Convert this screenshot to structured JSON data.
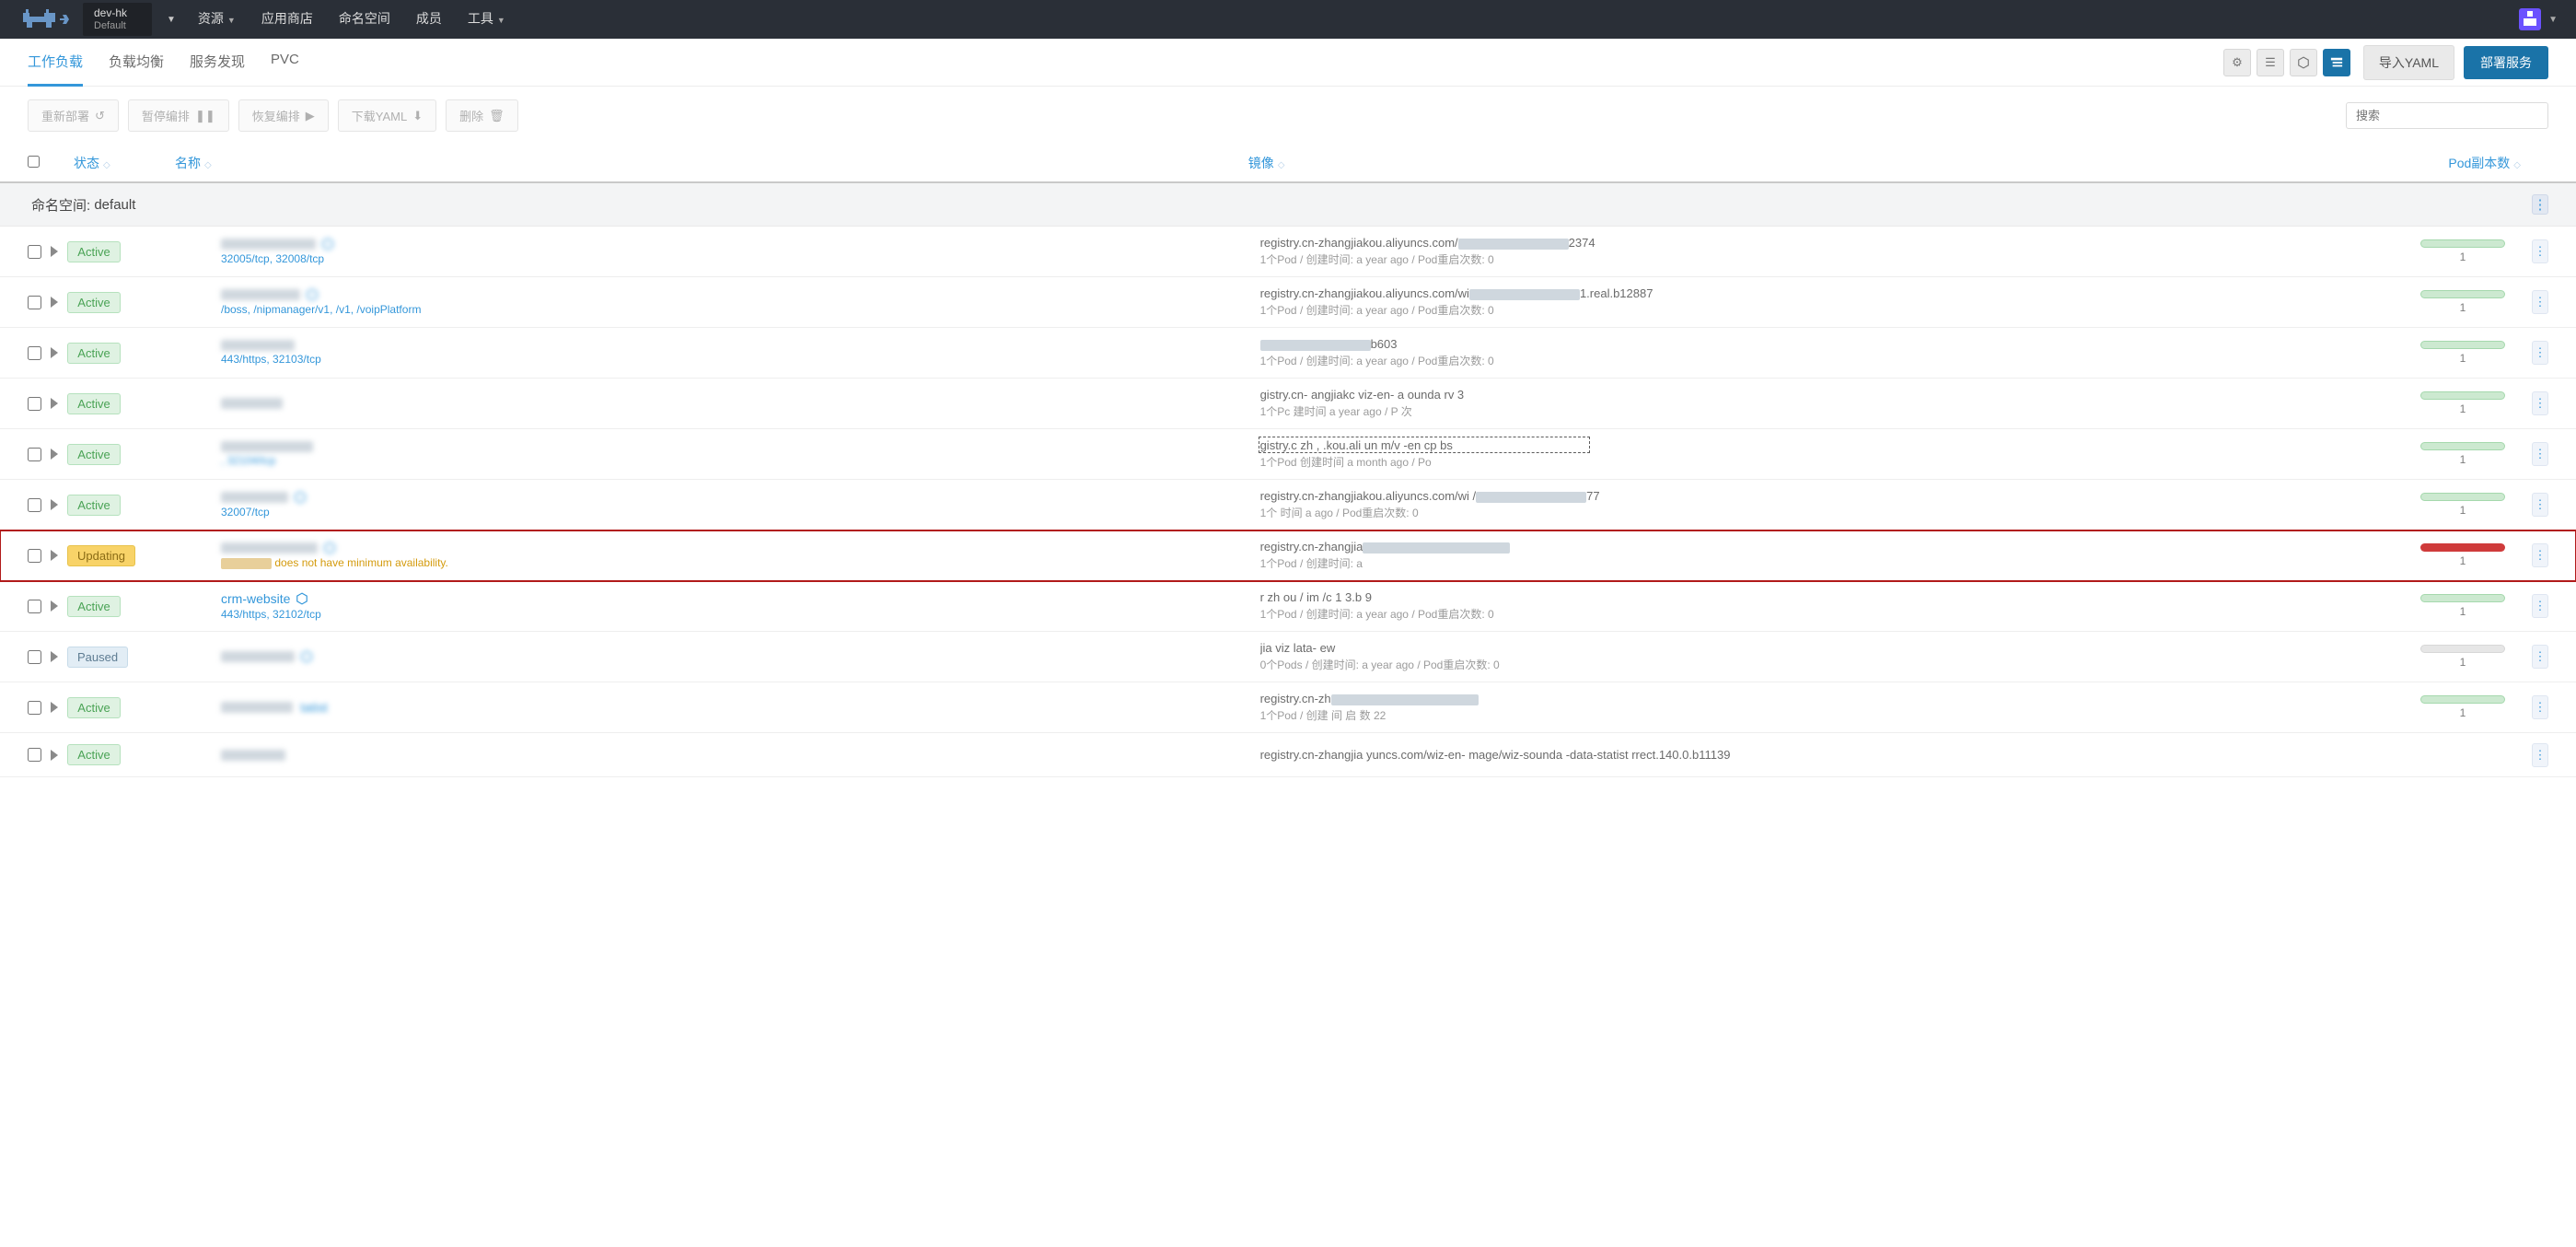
{
  "header": {
    "cluster_name": "dev-hk",
    "cluster_scope": "Default",
    "nav": {
      "resources": "资源",
      "catalog": "应用商店",
      "namespaces": "命名空间",
      "members": "成员",
      "tools": "工具"
    }
  },
  "subtabs": {
    "workloads": "工作负载",
    "loadbalancing": "负载均衡",
    "servicediscovery": "服务发现",
    "pvc": "PVC"
  },
  "actions": {
    "import_yaml": "导入YAML",
    "deploy": "部署服务"
  },
  "bulk": {
    "redeploy": "重新部署",
    "pause": "暂停编排",
    "resume": "恢复编排",
    "download_yaml": "下载YAML",
    "delete": "删除"
  },
  "search": {
    "placeholder": "搜索"
  },
  "table": {
    "columns": {
      "status": "状态",
      "name": "名称",
      "image": "镜像",
      "replicas": "Pod副本数"
    }
  },
  "namespace_group": {
    "label_prefix": "命名空间:",
    "name": "default"
  },
  "statuses": {
    "active": "Active",
    "updating": "Updating",
    "paused": "Paused"
  },
  "rows": [
    {
      "status": "active",
      "name_blur": true,
      "subtitle": "32005/tcp, 32008/tcp",
      "link_icon": true,
      "image_prefix": "registry.cn-zhangjiakou.aliyuncs.com/",
      "image_suffix": "2374",
      "pod_line": "1个Pod / 创建时间: a year ago / Pod重启次数: 0",
      "replicas": 1,
      "bar": "green"
    },
    {
      "status": "active",
      "name_blur": true,
      "subtitle": "/boss, /nipmanager/v1, /v1, /voipPlatform",
      "link_icon": true,
      "image_prefix": "registry.cn-zhangjiakou.aliyuncs.com/wi",
      "image_suffix": "1.real.b12887",
      "pod_line": "1个Pod / 创建时间: a year ago / Pod重启次数: 0",
      "replicas": 1,
      "bar": "green"
    },
    {
      "status": "active",
      "name_blur": true,
      "subtitle": "443/https, 32103/tcp",
      "link_icon": false,
      "image_prefix": "",
      "image_suffix": "b603",
      "pod_line": "1个Pod / 创建时间: a year ago / Pod重启次数: 0",
      "replicas": 1,
      "bar": "green"
    },
    {
      "status": "active",
      "name_blur": true,
      "subtitle": "",
      "link_icon": false,
      "image_prefix": "gistry.cn-   angjiakc             viz-en-   a         ounda    rv               3",
      "image_suffix": "",
      "pod_line": "1个Pc    建时间  a year ago / P    次",
      "replicas": 1,
      "bar": "green"
    },
    {
      "status": "active",
      "name_blur": true,
      "subtitle": ", 32104/tcp",
      "subtitle_blur": true,
      "link_icon": false,
      "image_prefix": "gistry.c   zh   , .kou.ali  un     m/v   -en           cp    bs",
      "image_suffix": "",
      "dashed": true,
      "pod_line": "1个Pod    创建时间   a month ago / Po",
      "replicas": 1,
      "bar": "green"
    },
    {
      "status": "active",
      "name_blur": true,
      "subtitle": "32007/tcp",
      "link_icon": true,
      "image_prefix": "registry.cn-zhangjiakou.aliyuncs.com/wi            /",
      "image_suffix": "77",
      "pod_line": "1个        时间  a       ago / Pod重启次数: 0",
      "replicas": 1,
      "bar": "green"
    },
    {
      "status": "updating",
      "name_blur": true,
      "subtitle": "",
      "link_icon": true,
      "warn": "does not have minimum availability.",
      "warn_prefix_blur": true,
      "image_prefix": "registry.cn-zhangjia",
      "image_suffix": "",
      "pod_line": "1个Pod / 创建时间: a",
      "replicas": 1,
      "bar": "red",
      "highlight": true
    },
    {
      "status": "active",
      "name": "crm-website",
      "name_blur": false,
      "subtitle": "443/https, 32102/tcp",
      "link_icon": true,
      "image_prefix": "r        zh       ou        /      im           /c              1     3.b     9",
      "image_suffix": "",
      "pod_line": "1个Pod / 创建时间: a year ago / Pod重启次数: 0",
      "replicas": 1,
      "bar": "green"
    },
    {
      "status": "paused",
      "name_blur": true,
      "subtitle": "",
      "link_icon": true,
      "image_prefix": "                jia                          viz                                  lata-    ew",
      "image_suffix": "",
      "pod_line": "0个Pods / 创建时间: a year ago / Pod重启次数: 0",
      "replicas": 1,
      "bar": "gray"
    },
    {
      "status": "active",
      "name_blur": true,
      "name_partial": "tatist",
      "subtitle": "",
      "link_icon": false,
      "image_prefix": "registry.cn-zh",
      "image_suffix": "",
      "pod_line": "1个Pod / 创建   间                                 启  数  22",
      "replicas": 1,
      "bar": "green"
    },
    {
      "status": "active",
      "name_blur": true,
      "subtitle": "",
      "link_icon": false,
      "image_prefix": "registry.cn-zhangjia     yuncs.com/wiz-en- mage/wiz-sounda -data-statist     rrect.140.0.b11139",
      "image_suffix": "",
      "pod_line": "",
      "replicas": null,
      "bar": null
    }
  ]
}
